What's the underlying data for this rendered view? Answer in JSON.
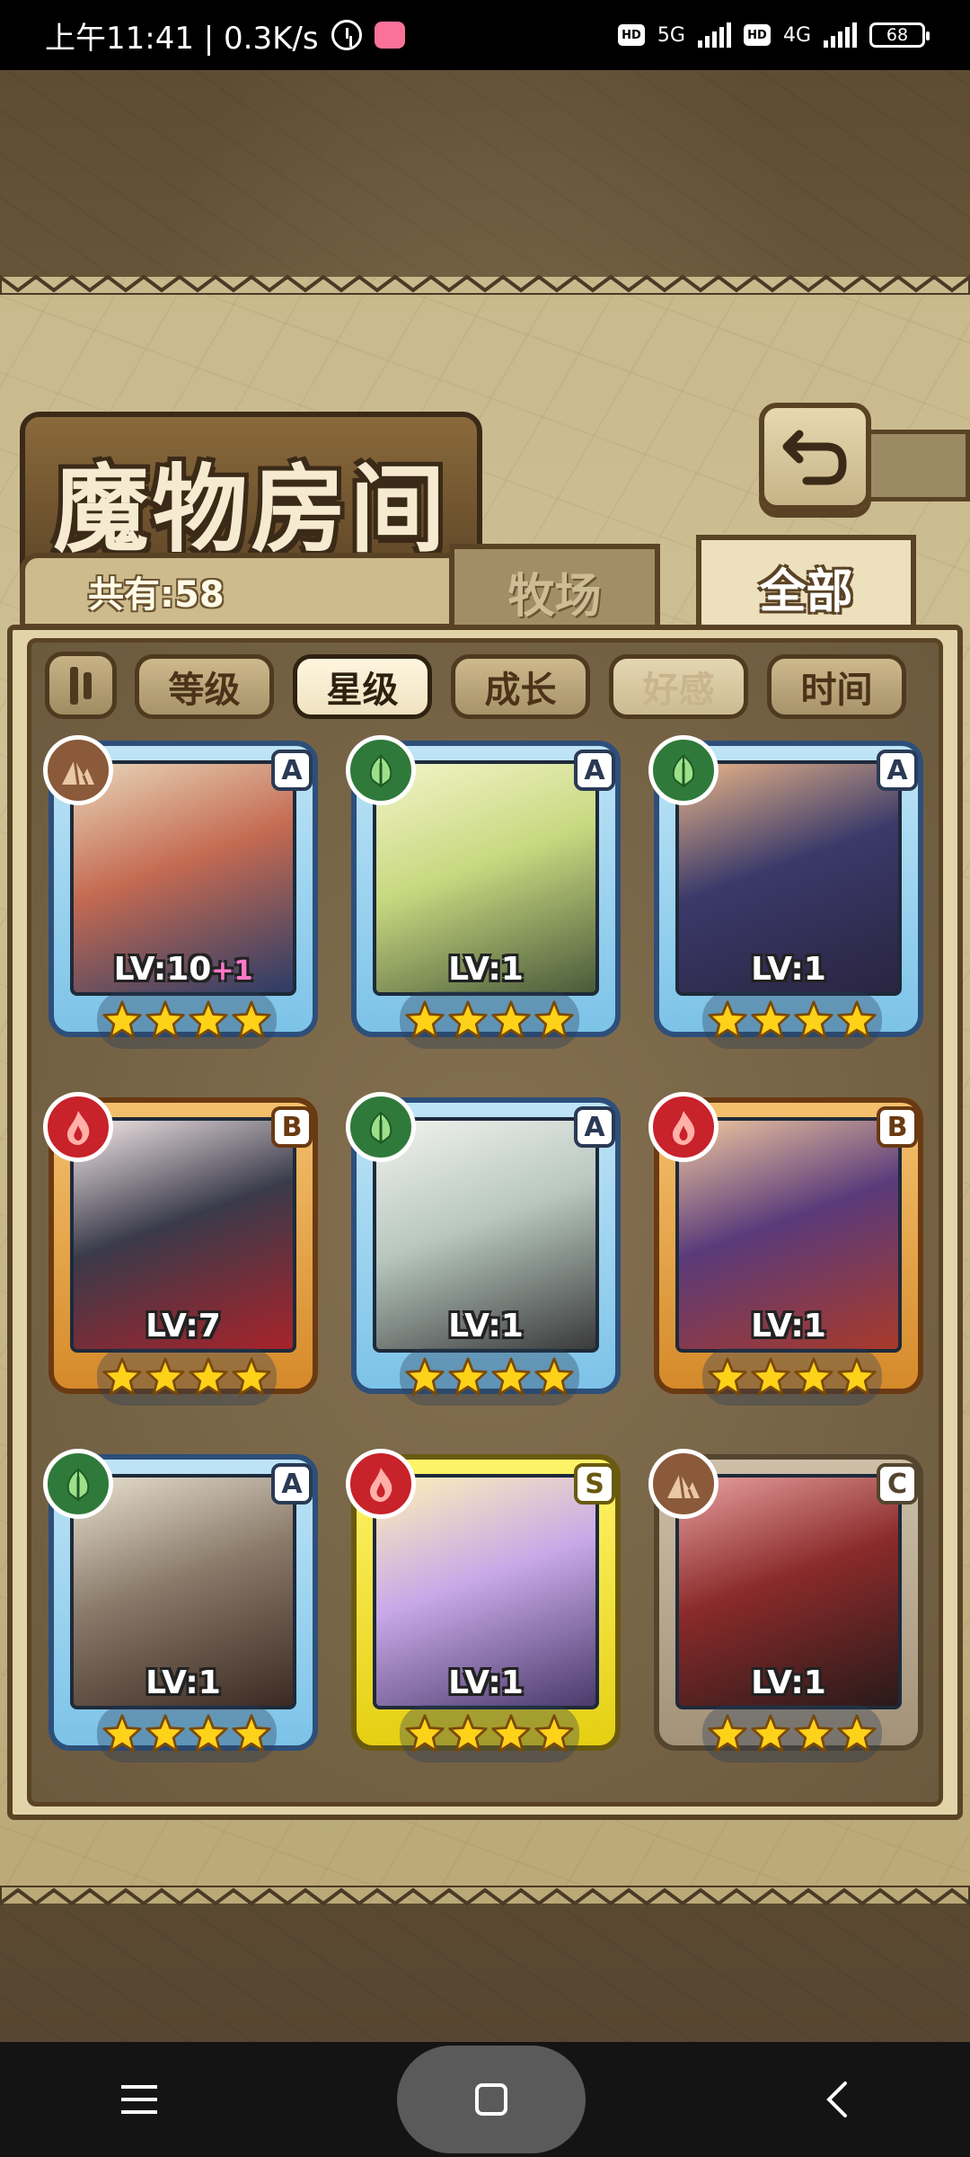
{
  "status_bar": {
    "time_speed": "上午11:41 | 0.3K/s",
    "app_badge": "bilibili",
    "hd1": "HD",
    "net1": "5G",
    "hd2": "HD",
    "net2": "4G",
    "battery": "68"
  },
  "header": {
    "title": "魔物房间"
  },
  "tabs": {
    "count_label": "共有:58",
    "farm": "牧场",
    "all": "全部"
  },
  "sort": {
    "buttons": [
      "等级",
      "星级",
      "成长",
      "好感",
      "时间"
    ],
    "active": "星级"
  },
  "cards": [
    {
      "rank": "A",
      "element": "earth",
      "level": "LV:10",
      "bonus": "+1",
      "stars": 4
    },
    {
      "rank": "A",
      "element": "leaf",
      "level": "LV:1",
      "bonus": "",
      "stars": 4
    },
    {
      "rank": "A",
      "element": "leaf",
      "level": "LV:1",
      "bonus": "",
      "stars": 4
    },
    {
      "rank": "B",
      "element": "fire",
      "level": "LV:7",
      "bonus": "",
      "stars": 4
    },
    {
      "rank": "A",
      "element": "leaf",
      "level": "LV:1",
      "bonus": "",
      "stars": 4
    },
    {
      "rank": "B",
      "element": "fire",
      "level": "LV:1",
      "bonus": "",
      "stars": 4
    },
    {
      "rank": "A",
      "element": "leaf",
      "level": "LV:1",
      "bonus": "",
      "stars": 4
    },
    {
      "rank": "S",
      "element": "fire",
      "level": "LV:1",
      "bonus": "",
      "stars": 4
    },
    {
      "rank": "C",
      "element": "earth",
      "level": "LV:1",
      "bonus": "",
      "stars": 4
    }
  ],
  "colors": {
    "accent": "#5a4325",
    "rank_A": "#7cc3e8",
    "rank_B": "#d58a2a",
    "rank_S": "#e5cf12",
    "rank_C": "#a39278"
  }
}
